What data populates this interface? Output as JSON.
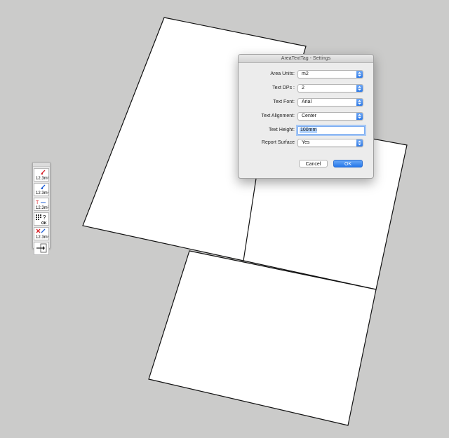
{
  "dialog": {
    "title": "AreaTextTag - Settings",
    "fields": [
      {
        "label": "Area Units:",
        "value": "m2"
      },
      {
        "label": "Text DPs :",
        "value": "2"
      },
      {
        "label": "Text Font:",
        "value": "Arial"
      },
      {
        "label": "Text Alignment:",
        "value": "Center"
      },
      {
        "label": "Text Height:",
        "value": "100mm"
      },
      {
        "label": "Report Surface",
        "value": "Yes"
      }
    ],
    "cancel_label": "Cancel",
    "ok_label": "OK"
  },
  "toolbar": {
    "tools": [
      {
        "icon": "tag-area-icon",
        "text": "12.3m²"
      },
      {
        "icon": "tag-area-blue-icon",
        "text": "12.3m²"
      },
      {
        "icon": "edit-tag-icon",
        "text": "12.3m²"
      },
      {
        "icon": "report-icon",
        "text": "OK"
      },
      {
        "icon": "update-tags-icon",
        "text": "12.3m²"
      },
      {
        "icon": "export-icon",
        "text": ""
      }
    ]
  },
  "colors": {
    "background": "#cbcbca",
    "accent": "#2f7ae6",
    "sheet": "#ffffff"
  }
}
